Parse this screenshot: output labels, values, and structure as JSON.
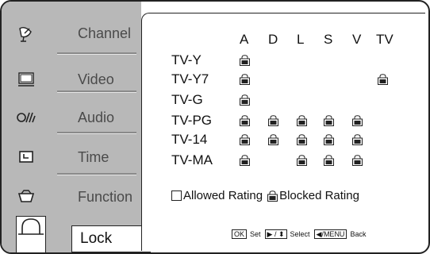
{
  "sidebar": {
    "items": [
      {
        "label": "Channel",
        "icon": "satellite-dish-icon"
      },
      {
        "label": "Video",
        "icon": "monitor-icon"
      },
      {
        "label": "Audio",
        "icon": "audio-wave-icon"
      },
      {
        "label": "Time",
        "icon": "clock-box-icon"
      },
      {
        "label": "Function",
        "icon": "function-tray-icon"
      }
    ],
    "selected": {
      "label": "Lock",
      "icon": "padlock-icon"
    }
  },
  "ratings": {
    "columns": [
      "A",
      "D",
      "L",
      "S",
      "V",
      "TV"
    ],
    "rows": [
      {
        "label": "TV-Y",
        "blocked": [
          true,
          false,
          false,
          false,
          false,
          false
        ]
      },
      {
        "label": "TV-Y7",
        "blocked": [
          true,
          false,
          false,
          false,
          false,
          true
        ]
      },
      {
        "label": "TV-G",
        "blocked": [
          true,
          false,
          false,
          false,
          false,
          false
        ]
      },
      {
        "label": "TV-PG",
        "blocked": [
          true,
          true,
          true,
          true,
          true,
          false
        ]
      },
      {
        "label": "TV-14",
        "blocked": [
          true,
          true,
          true,
          true,
          true,
          false
        ]
      },
      {
        "label": "TV-MA",
        "blocked": [
          true,
          false,
          true,
          true,
          true,
          false
        ]
      }
    ]
  },
  "legend": {
    "allowed": "Allowed Rating",
    "blocked": "Blocked Rating"
  },
  "hints": {
    "ok_key": "OK",
    "set": "Set",
    "nav_key": "▶ / ⬍",
    "select": "Select",
    "menu_key": "◀/MENU",
    "back": "Back"
  },
  "colors": {
    "sidebar_bg": "#b8b8b8",
    "label_gray": "#4a4a4a"
  }
}
